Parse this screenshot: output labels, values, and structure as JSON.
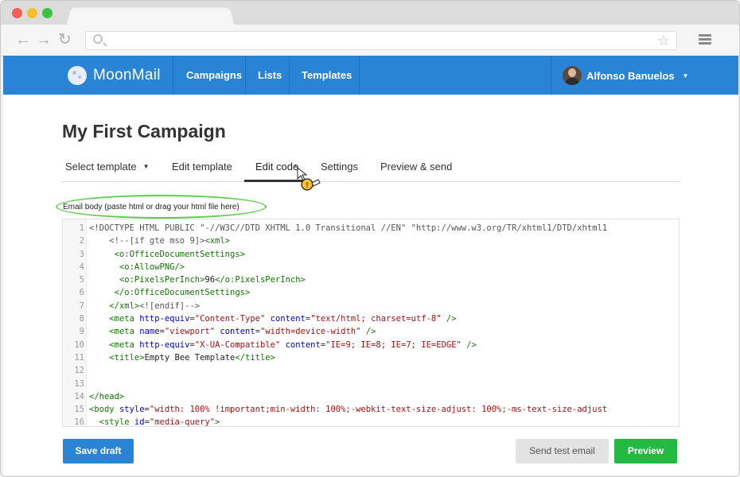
{
  "app": {
    "name": "MoonMail",
    "nav": [
      "Campaigns",
      "Lists",
      "Templates"
    ],
    "user": "Alfonso Banuelos"
  },
  "campaign": {
    "title": "My First Campaign",
    "tabs": [
      {
        "label": "Select template",
        "has_caret": true
      },
      {
        "label": "Edit template"
      },
      {
        "label": "Edit code",
        "active": true
      },
      {
        "label": "Settings"
      },
      {
        "label": "Preview & send"
      }
    ]
  },
  "editor": {
    "label": "Email body (paste html or drag your html file here)",
    "line_numbers": [
      "1",
      "2",
      "3",
      "4",
      "5",
      "6",
      "7",
      "8",
      "9",
      "10",
      "11",
      "12",
      "13",
      "14",
      "15",
      "16"
    ]
  },
  "buttons": {
    "save": "Save draft",
    "test": "Send test email",
    "preview": "Preview"
  },
  "colors": {
    "brand": "#2a84d6",
    "preview": "#23b943",
    "highlight": "#5bcf4d"
  },
  "icons": [
    "back-arrow-icon",
    "forward-arrow-icon",
    "reload-icon",
    "search-icon",
    "star-icon",
    "menu-icon",
    "moon-logo-icon",
    "chevron-down-icon",
    "drag-cursor-icon"
  ]
}
